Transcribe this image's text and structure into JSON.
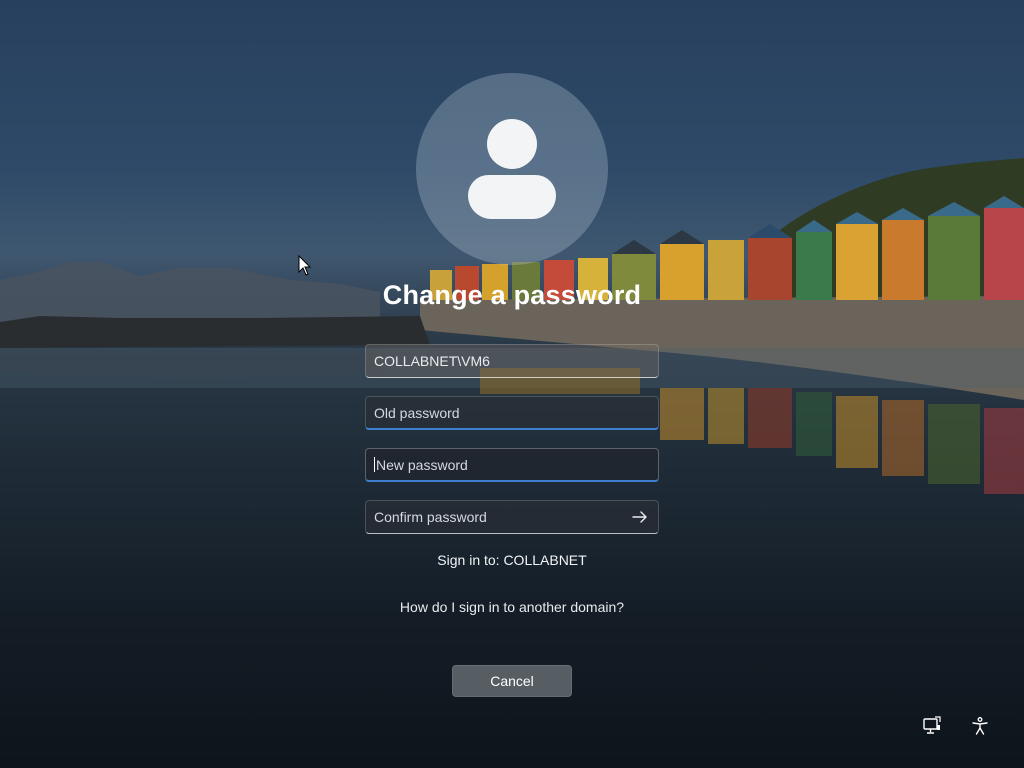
{
  "dialog": {
    "title": "Change a password",
    "username_value": "COLLABNET\\VM6",
    "old_password_placeholder": "Old password",
    "new_password_placeholder": "New password",
    "confirm_password_placeholder": "Confirm password",
    "sign_in_to": "Sign in to: COLLABNET",
    "other_domain_link": "How do I sign in to another domain?",
    "cancel_label": "Cancel"
  },
  "icons": {
    "avatar": "user-avatar-icon",
    "submit": "arrow-right-icon",
    "network": "network-icon",
    "accessibility": "accessibility-icon"
  },
  "colors": {
    "focus_accent": "#3f7fcf",
    "text": "#ffffff"
  }
}
